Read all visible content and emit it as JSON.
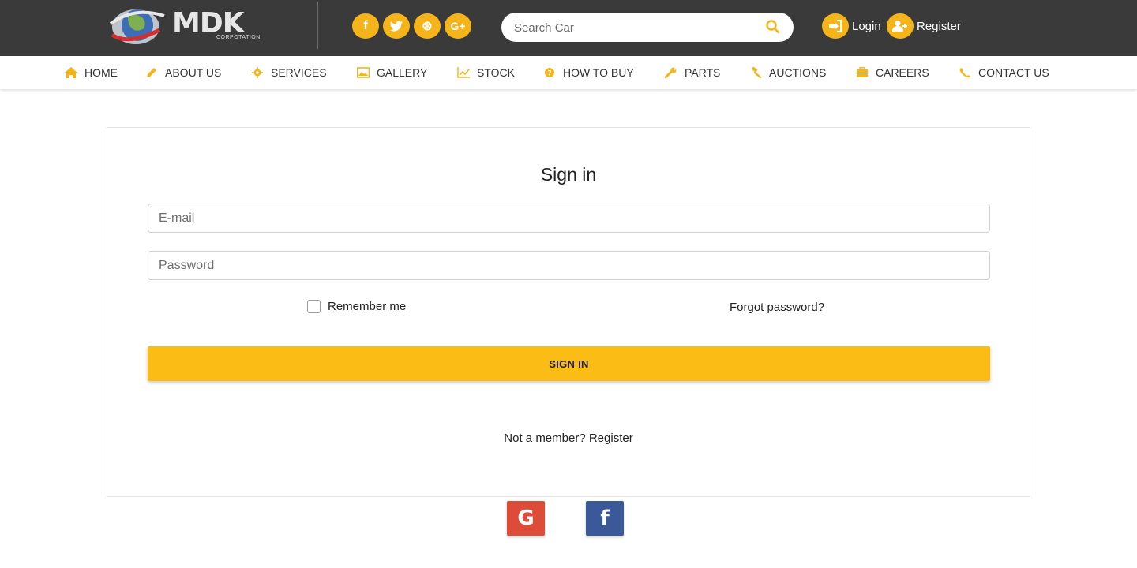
{
  "brand": {
    "name": "MDK",
    "subtitle": "CORPOTATION"
  },
  "social": [
    {
      "icon": "facebook-icon",
      "glyph": "f"
    },
    {
      "icon": "twitter-icon",
      "glyph": "t"
    },
    {
      "icon": "dribbble-icon",
      "glyph": "⊛"
    },
    {
      "icon": "google-plus-icon",
      "glyph": "G+"
    }
  ],
  "search": {
    "placeholder": "Search Car"
  },
  "auth": {
    "login_label": "Login",
    "register_label": "Register"
  },
  "nav": [
    {
      "label": "HOME",
      "icon": "home-icon"
    },
    {
      "label": "ABOUT US",
      "icon": "pencil-icon"
    },
    {
      "label": "SERVICES",
      "icon": "gear-icon"
    },
    {
      "label": "GALLERY",
      "icon": "image-icon"
    },
    {
      "label": "STOCK",
      "icon": "chart-line-icon"
    },
    {
      "label": "HOW TO BUY",
      "icon": "question-icon"
    },
    {
      "label": "PARTS",
      "icon": "wrench-icon"
    },
    {
      "label": "AUCTIONS",
      "icon": "gavel-icon"
    },
    {
      "label": "CAREERS",
      "icon": "briefcase-icon"
    },
    {
      "label": "CONTACT US",
      "icon": "phone-icon"
    }
  ],
  "form": {
    "title": "Sign in",
    "email_placeholder": "E-mail",
    "password_placeholder": "Password",
    "remember_label": "Remember me",
    "remember_checked": false,
    "forgot_label": "Forgot password?",
    "submit_label": "SIGN IN",
    "register_prompt": "Not a member? Register"
  },
  "social_login": {
    "google_glyph": "G",
    "facebook_glyph": "f"
  },
  "colors": {
    "accent": "#fbbc16",
    "topbar": "#3a3a3a",
    "google": "#dd4b39",
    "facebook": "#3b5998"
  }
}
